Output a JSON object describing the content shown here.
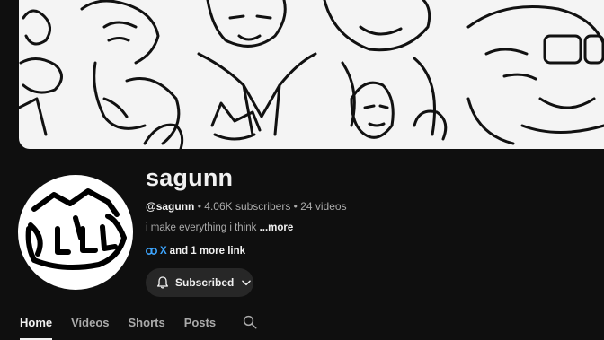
{
  "channel": {
    "name": "sagunn",
    "handle": "@sagunn",
    "subscribers": "4.06K subscribers",
    "separator": "•",
    "videos": "24 videos",
    "description": "i make everything i think",
    "more_label": "...more",
    "links_primary": "X",
    "links_more": "and 1 more link",
    "subscribe_label": "Subscribed"
  },
  "tabs": [
    {
      "label": "Home",
      "active": true
    },
    {
      "label": "Videos",
      "active": false
    },
    {
      "label": "Shorts",
      "active": false
    },
    {
      "label": "Posts",
      "active": false
    }
  ],
  "icons": {
    "bell": "bell-icon",
    "chevron": "chevron-down-icon",
    "search": "search-icon",
    "link": "link-icon"
  },
  "colors": {
    "background": "#0f0f0f",
    "link_blue": "#3ea6ff",
    "button_bg": "#272727"
  }
}
